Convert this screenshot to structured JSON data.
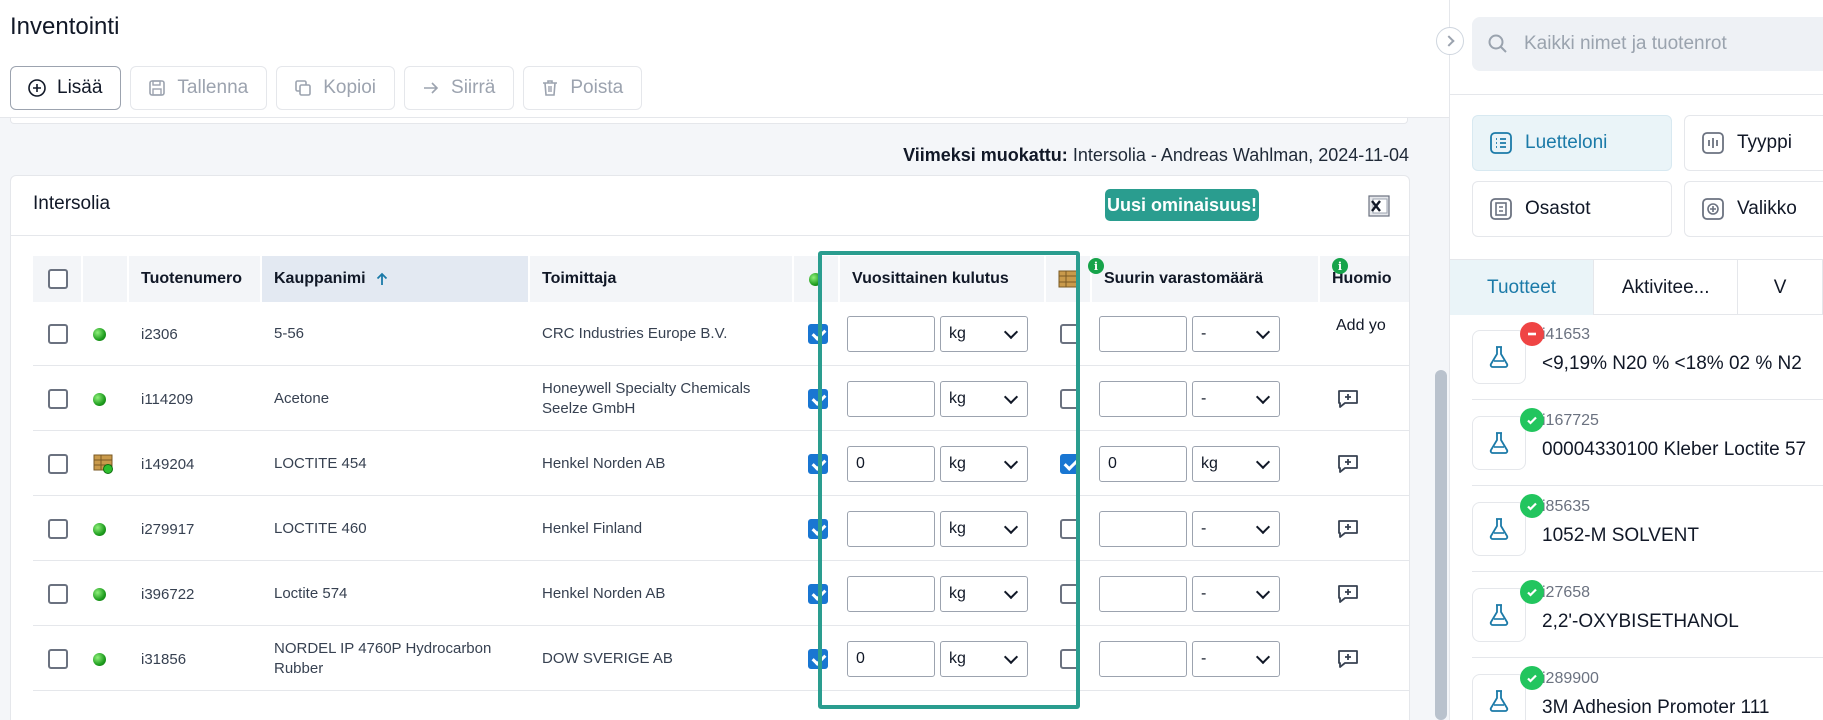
{
  "page": {
    "title": "Inventointi"
  },
  "toolbar": {
    "add": "Lisää",
    "save": "Tallenna",
    "copy": "Kopioi",
    "move": "Siirrä",
    "delete": "Poista"
  },
  "last_modified": {
    "label": "Viimeksi muokattu:",
    "value": "Intersolia - Andreas Wahlman, 2024-11-04"
  },
  "card": {
    "title": "Intersolia",
    "new_feature": "Uusi ominaisuus!"
  },
  "table": {
    "headers": {
      "product_number": "Tuotenumero",
      "trade_name": "Kauppanimi",
      "supplier": "Toimittaja",
      "annual_consumption": "Vuosittainen kulutus",
      "max_storage": "Suurin varastomäärä",
      "notes": "Huomio"
    },
    "notes_placeholder": "Add yo",
    "rows": [
      {
        "status": "green",
        "product_number": "i2306",
        "trade_name": "5-56",
        "supplier": "CRC Industries Europe B.V.",
        "consumption_checked": true,
        "consumption_value": "",
        "consumption_unit": "kg",
        "storage_checked": false,
        "storage_value": "",
        "storage_unit": "-",
        "note": "text"
      },
      {
        "status": "green",
        "product_number": "i114209",
        "trade_name": "Acetone",
        "supplier": "Honeywell Specialty Chemicals Seelze GmbH",
        "consumption_checked": true,
        "consumption_value": "",
        "consumption_unit": "kg",
        "storage_checked": false,
        "storage_value": "",
        "storage_unit": "-",
        "note": "icon"
      },
      {
        "status": "box",
        "product_number": "i149204",
        "trade_name": "LOCTITE 454",
        "supplier": "Henkel Norden AB",
        "consumption_checked": true,
        "consumption_value": "0",
        "consumption_unit": "kg",
        "storage_checked": true,
        "storage_value": "0",
        "storage_unit": "kg",
        "note": "icon"
      },
      {
        "status": "green",
        "product_number": "i279917",
        "trade_name": "LOCTITE 460",
        "supplier": "Henkel Finland",
        "consumption_checked": true,
        "consumption_value": "",
        "consumption_unit": "kg",
        "storage_checked": false,
        "storage_value": "",
        "storage_unit": "-",
        "note": "icon"
      },
      {
        "status": "green",
        "product_number": "i396722",
        "trade_name": "Loctite 574",
        "supplier": "Henkel Norden AB",
        "consumption_checked": true,
        "consumption_value": "",
        "consumption_unit": "kg",
        "storage_checked": false,
        "storage_value": "",
        "storage_unit": "-",
        "note": "icon"
      },
      {
        "status": "green",
        "product_number": "i31856",
        "trade_name": "NORDEL IP 4760P Hydrocarbon Rubber",
        "supplier": "DOW SVERIGE AB",
        "consumption_checked": true,
        "consumption_value": "0",
        "consumption_unit": "kg",
        "storage_checked": false,
        "storage_value": "",
        "storage_unit": "-",
        "note": "icon"
      }
    ]
  },
  "sidebar": {
    "search_placeholder": "Kaikki nimet ja tuotenrot",
    "views": [
      "Luetteloni",
      "Tyyppi",
      "Osastot",
      "Valikko"
    ],
    "tabs": [
      "Tuotteet",
      "Aktivitee...",
      "V"
    ],
    "products": [
      {
        "id": "i41653",
        "name": "<9,19% N20 % <18% 02 % N2",
        "badge": "no"
      },
      {
        "id": "i167725",
        "name": "00004330100 Kleber Loctite 57",
        "badge": "ok"
      },
      {
        "id": "i85635",
        "name": "1052-M SOLVENT",
        "badge": "ok"
      },
      {
        "id": "i27658",
        "name": "2,2'-OXYBISETHANOL",
        "badge": "ok"
      },
      {
        "id": "i289900",
        "name": "3M Adhesion Promoter 111",
        "badge": "ok"
      }
    ]
  },
  "colors": {
    "accent": "#2a9d8f",
    "link": "#1b7aa8",
    "checkbox": "#1976d2"
  }
}
